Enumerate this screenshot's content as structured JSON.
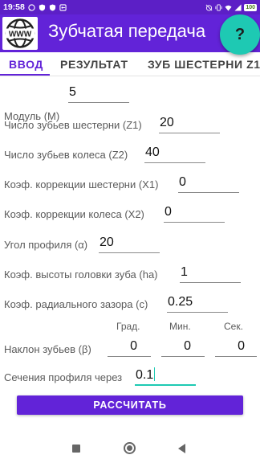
{
  "status_bar": {
    "time": "19:58",
    "battery": "100",
    "icons": [
      "whatsapp-icon",
      "shield-icon",
      "shield-icon",
      "vpn-key-icon",
      "alarm-off-icon",
      "vibrate-icon",
      "wifi-icon",
      "signal-icon",
      "battery-icon"
    ]
  },
  "app": {
    "title": "Зубчатая передача",
    "logo_text": "WWW",
    "help_label": "?",
    "accent_color": "#6223d8",
    "fab_color": "#1ec9b3"
  },
  "tabs": [
    {
      "label": "ВВОД",
      "active": true
    },
    {
      "label": "РЕЗУЛЬТАТ",
      "active": false
    },
    {
      "label": "ЗУБ ШЕСТЕРНИ Z1",
      "active": false
    }
  ],
  "form": {
    "module": {
      "label": "Модуль (M)",
      "value": "5"
    },
    "z1": {
      "label": "Число зубьев шестерни (Z1)",
      "value": "20"
    },
    "z2": {
      "label": "Число зубьев колеса (Z2)",
      "value": "40"
    },
    "x1": {
      "label": "Коэф. коррекции шестерни (X1)",
      "value": "0"
    },
    "x2": {
      "label": "Коэф. коррекции колеса (X2)",
      "value": "0"
    },
    "alpha": {
      "label": "Угол профиля (α)",
      "value": "20"
    },
    "ha": {
      "label": "Коэф. высоты головки зуба (ha)",
      "value": "1"
    },
    "c": {
      "label": "Коэф. радиального зазора (c)",
      "value": "0.25"
    },
    "beta": {
      "label": "Наклон зубьев (β)",
      "col_deg": "Град.",
      "col_min": "Мин.",
      "col_sec": "Сек.",
      "deg": "0",
      "min": "0",
      "sec": "0"
    },
    "section": {
      "label": "Сечения профиля через",
      "value": "0.1"
    }
  },
  "calculate_label": "РАССЧИТАТЬ"
}
